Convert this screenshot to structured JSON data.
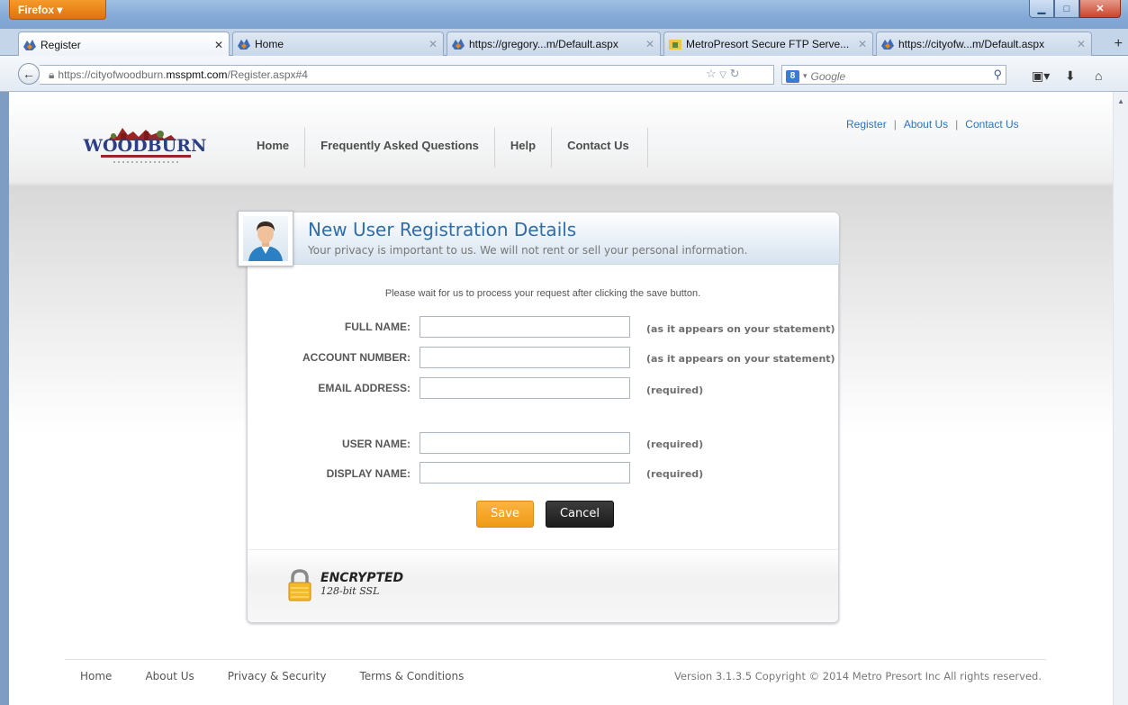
{
  "browser": {
    "app_button": "Firefox",
    "tabs": [
      {
        "label": "Register",
        "active": true
      },
      {
        "label": "Home",
        "active": false
      },
      {
        "label": "https://gregory...m/Default.aspx",
        "active": false
      },
      {
        "label": "MetroPresort Secure FTP Serve...",
        "active": false
      },
      {
        "label": "https://cityofw...m/Default.aspx",
        "active": false
      }
    ],
    "url": {
      "prefix": "https://cityofwoodburn.",
      "domain": "msspmt.com",
      "path": "/Register.aspx#4"
    },
    "search_engine": "8",
    "search_placeholder": "Google"
  },
  "site": {
    "logo_text": "WOODBURN",
    "nav": [
      "Home",
      "Frequently Asked Questions",
      "Help",
      "Contact Us"
    ],
    "top_links": [
      "Register",
      "About Us",
      "Contact Us"
    ]
  },
  "form": {
    "title": "New User Registration Details",
    "subtitle": "Your privacy is important to us. We will not rent or sell your personal information.",
    "wait_message": "Please wait for us to process your request after clicking the save button.",
    "fields": [
      {
        "label": "FULL NAME:",
        "value": "",
        "hint": "(as it appears on your statement)"
      },
      {
        "label": "ACCOUNT NUMBER:",
        "value": "",
        "hint": "(as it appears on your statement)"
      },
      {
        "label": "EMAIL ADDRESS:",
        "value": "",
        "hint": "(required)"
      },
      {
        "label": "USER NAME:",
        "value": "",
        "hint": "(required)"
      },
      {
        "label": "DISPLAY NAME:",
        "value": "",
        "hint": "(required)"
      }
    ],
    "save_label": "Save",
    "cancel_label": "Cancel",
    "encrypted_title": "ENCRYPTED",
    "encrypted_sub": "128-bit SSL"
  },
  "footer": {
    "links": [
      "Home",
      "About Us",
      "Privacy & Security",
      "Terms & Conditions"
    ],
    "copyright": "Version 3.1.3.5 Copyright © 2014 Metro Presort Inc All rights reserved."
  },
  "colors": {
    "accent_blue": "#2f6ea8",
    "save_orange": "#f09a16",
    "cancel_dark": "#1c1c1c",
    "logo_blue": "#2c3f86",
    "logo_red": "#9b2525"
  }
}
